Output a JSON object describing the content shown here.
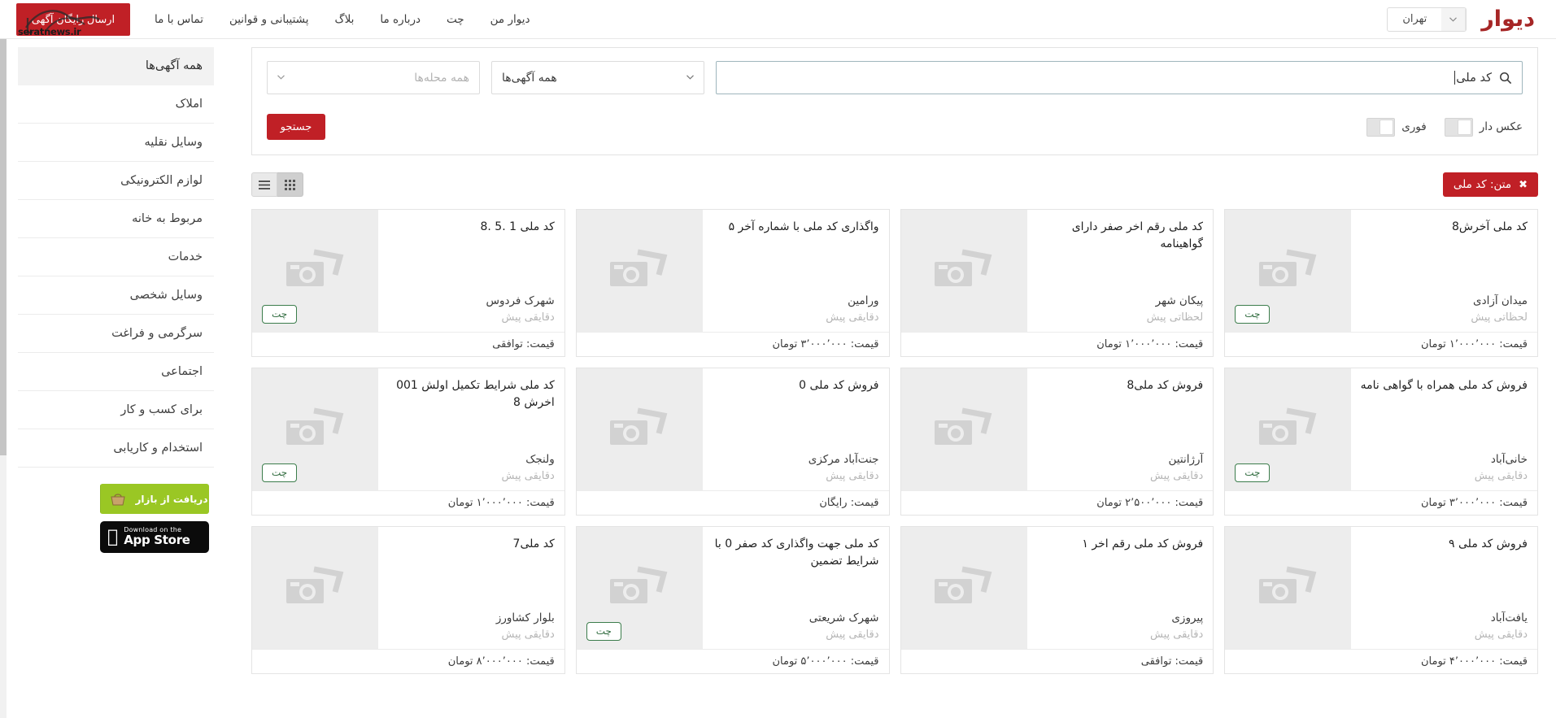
{
  "header": {
    "brand": "دیوار",
    "city": "تهران",
    "city_caret_icon": "chevron-down-icon",
    "post_ad_label": "ارسال رایگان آگهی",
    "watermark": "seratnews.ir",
    "nav_links": [
      {
        "label": "دیوار من"
      },
      {
        "label": "چت"
      },
      {
        "label": "درباره ما"
      },
      {
        "label": "بلاگ"
      },
      {
        "label": "پشتیبانی و قوانین"
      },
      {
        "label": "تماس با ما"
      }
    ]
  },
  "sidebar": {
    "categories": [
      {
        "label": "همه آگهی‌ها",
        "active": true
      },
      {
        "label": "املاک",
        "active": false
      },
      {
        "label": "وسایل نقلیه",
        "active": false
      },
      {
        "label": "لوازم الکترونیکی",
        "active": false
      },
      {
        "label": "مربوط به خانه",
        "active": false
      },
      {
        "label": "خدمات",
        "active": false
      },
      {
        "label": "وسایل شخصی",
        "active": false
      },
      {
        "label": "سرگرمی و فراغت",
        "active": false
      },
      {
        "label": "اجتماعی",
        "active": false
      },
      {
        "label": "برای کسب و کار",
        "active": false
      },
      {
        "label": "استخدام و کاریابی",
        "active": false
      }
    ],
    "badges": {
      "bazaar_label": "دریافت از بازار",
      "bazaar_icon": "basket-icon",
      "appstore_small": "Download on the",
      "appstore_big": "App Store",
      "appstore_icon": "apple-icon"
    }
  },
  "search": {
    "query_value": "کد ملی",
    "search_icon": "search-icon",
    "category_value": "همه آگهی‌ها",
    "neighborhood_placeholder": "همه محله‌ها",
    "caret_icon": "chevron-down-icon",
    "toggle_photo_label": "عکس دار",
    "toggle_urgent_label": "فوری",
    "submit_label": "جستجو"
  },
  "results": {
    "active_filter_label": "متن: کد ملی",
    "remove_icon": "close-icon",
    "grid_view_icon": "grid-view-icon",
    "list_view_icon": "list-view-icon",
    "price_prefix": "قیمت:",
    "chat_label": "چت",
    "thumb_icon": "camera-placeholder-icon",
    "ads": [
      {
        "title": "کد ملی آخرش8",
        "location": "میدان آزادی",
        "time": "لحظاتی پیش",
        "price": "قیمت: ۱٬۰۰۰٬۰۰۰ تومان",
        "chat": true
      },
      {
        "title": "کد ملی رقم اخر صفر دارای گواهینامه",
        "location": "پیکان شهر",
        "time": "لحظاتی پیش",
        "price": "قیمت: ۱٬۰۰۰٬۰۰۰ تومان",
        "chat": false
      },
      {
        "title": "واگذاری کد ملی با شماره آخر ۵",
        "location": "ورامین",
        "time": "دقایقی پیش",
        "price": "قیمت: ۳٬۰۰۰٬۰۰۰ تومان",
        "chat": false
      },
      {
        "title": "کد ملی 1 .5 .8",
        "location": "شهرک فردوس",
        "time": "دقایقی پیش",
        "price": "قیمت: توافقی",
        "chat": true
      },
      {
        "title": "فروش کد ملی همراه با گواهی نامه",
        "location": "خانی‌آباد",
        "time": "دقایقی پیش",
        "price": "قیمت: ۳٬۰۰۰٬۰۰۰ تومان",
        "chat": true
      },
      {
        "title": "فروش کد ملی8",
        "location": "آرژانتین",
        "time": "دقایقی پیش",
        "price": "قیمت: ۲٬۵۰۰٬۰۰۰ تومان",
        "chat": false
      },
      {
        "title": "فروش کد ملی 0",
        "location": "جنت‌آباد مرکزی",
        "time": "دقایقی پیش",
        "price": "قیمت: رایگان",
        "chat": false
      },
      {
        "title": "کد ملی شرایط تکمیل اولش 001 اخرش 8",
        "location": "ولنجک",
        "time": "دقایقی پیش",
        "price": "قیمت: ۱٬۰۰۰٬۰۰۰ تومان",
        "chat": true
      },
      {
        "title": "فروش کد ملی ۹",
        "location": "یافت‌آباد",
        "time": "دقایقی پیش",
        "price": "قیمت: ۴٬۰۰۰٬۰۰۰ تومان",
        "chat": false
      },
      {
        "title": "فروش کد ملی رقم اخر ۱",
        "location": "پیروزی",
        "time": "دقایقی پیش",
        "price": "قیمت: توافقی",
        "chat": false
      },
      {
        "title": "کد ملی جهت واگذاری کد صفر 0 با شرایط تضمین",
        "location": "شهرک شریعتی",
        "time": "دقایقی پیش",
        "price": "قیمت: ۵٬۰۰۰٬۰۰۰ تومان",
        "chat": true
      },
      {
        "title": "کد ملی7",
        "location": "بلوار کشاورز",
        "time": "دقایقی پیش",
        "price": "قیمت: ۸٬۰۰۰٬۰۰۰ تومان",
        "chat": false
      }
    ]
  },
  "colors": {
    "brand_red": "#a62626",
    "accent_red": "#c02026",
    "chat_green": "#3c7d4c",
    "bazaar_green": "#9ac724"
  }
}
